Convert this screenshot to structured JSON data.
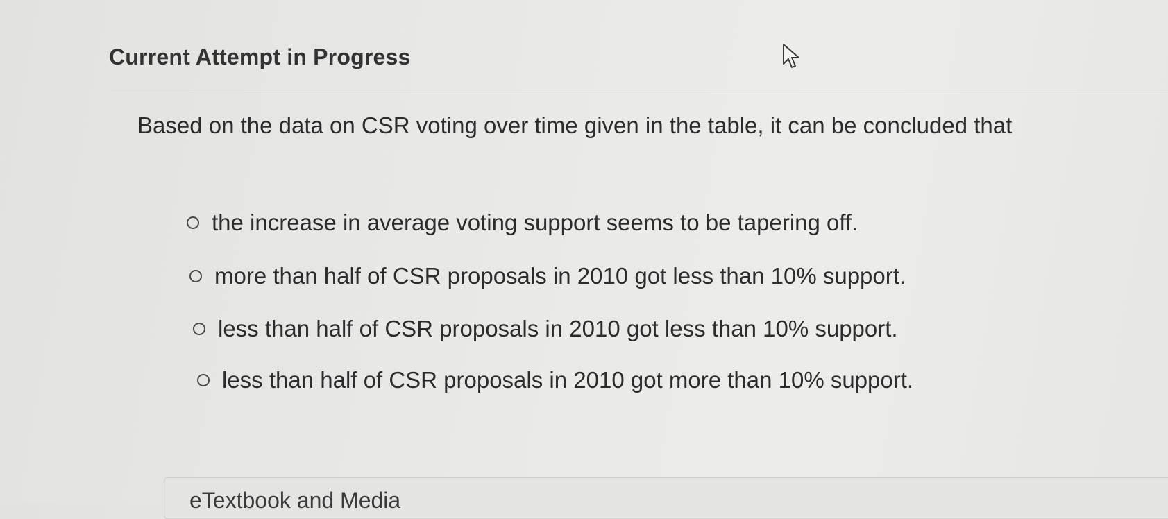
{
  "header": {
    "title": "Current Attempt in Progress"
  },
  "question": {
    "prompt": "Based on the data on CSR voting over time given in the table, it can be concluded that",
    "options": [
      {
        "label": "the increase in average voting support seems to be tapering off.",
        "selected": false
      },
      {
        "label": "more than half of CSR proposals in 2010 got less than 10% support.",
        "selected": false
      },
      {
        "label": "less than half of CSR proposals in 2010 got less than 10% support.",
        "selected": false
      },
      {
        "label": "less than half of CSR proposals in 2010 got more than 10% support.",
        "selected": false
      }
    ]
  },
  "media": {
    "label": "eTextbook and Media"
  },
  "icons": {
    "cursor": "mouse-pointer-icon",
    "radio": "radio-circle-icon"
  }
}
